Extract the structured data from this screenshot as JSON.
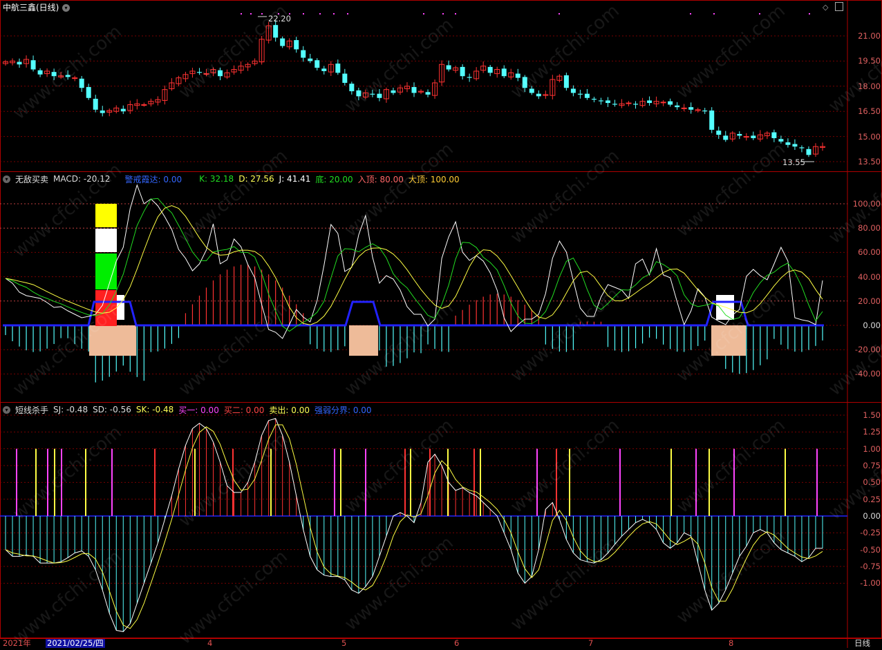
{
  "main": {
    "title": "中航三鑫(日线)",
    "high_label": "22.20",
    "low_label": "13.55",
    "axis": [
      "21.00",
      "19.50",
      "18.00",
      "16.50",
      "15.00",
      "13.50"
    ]
  },
  "ind1": {
    "name": "无敌买卖",
    "macd": "MACD: -20.12",
    "warn": "警戒霞达: 0.00",
    "k": "K: 32.18",
    "d": "D: 27.56",
    "j": "J: 41.41",
    "bottom": "底: 20.00",
    "entry": "入顶: 80.00",
    "top": "大顶: 100.00",
    "axis": [
      "100.00",
      "80.00",
      "60.00",
      "40.00",
      "20.00",
      "0.00",
      "-20.00",
      "-40.00"
    ]
  },
  "ind2": {
    "name": "短线杀手",
    "sj": "SJ: -0.48",
    "sd": "SD: -0.56",
    "sk": "SK: -0.48",
    "buy1": "买一: 0.00",
    "buy2": "买二: 0.00",
    "sell": "卖出: 0.00",
    "divide": "强弱分界: 0.00",
    "axis": [
      "1.50",
      "1.25",
      "1.00",
      "0.75",
      "0.50",
      "0.25",
      "0.00",
      "-0.25",
      "-0.50",
      "-0.75",
      "-1.00"
    ]
  },
  "timebar": {
    "year": "2021年",
    "cursor": "2021/02/25/四",
    "months": [
      "4",
      "5",
      "6",
      "7",
      "8"
    ],
    "period": "日线"
  },
  "watermark": "www.cfchi.com",
  "colors": {
    "up": "#ff3232",
    "down": "#54ffff",
    "kline": "#ffffff",
    "dline": "#22dd22",
    "jline": "#ffff44",
    "blue": "#2222ff"
  },
  "chart_data": {
    "type": "candlestick",
    "closes": [
      19.45,
      19.5,
      19.3,
      19.6,
      19.0,
      18.7,
      18.9,
      18.6,
      18.62,
      18.55,
      18.5,
      17.9,
      17.3,
      16.6,
      16.4,
      16.55,
      16.7,
      16.5,
      16.9,
      16.95,
      16.9,
      17.1,
      17.2,
      17.8,
      18.2,
      18.5,
      18.7,
      18.9,
      18.8,
      18.75,
      19.0,
      18.6,
      18.8,
      19.0,
      19.2,
      19.3,
      19.5,
      20.8,
      21.6,
      20.9,
      20.4,
      20.7,
      20.2,
      19.7,
      19.5,
      19.1,
      18.9,
      19.3,
      18.8,
      18.2,
      17.7,
      17.4,
      17.6,
      17.5,
      17.3,
      17.8,
      17.6,
      17.9,
      18.0,
      17.6,
      17.7,
      17.5,
      18.2,
      19.3,
      19.0,
      19.1,
      18.6,
      18.5,
      18.9,
      19.2,
      18.8,
      19.0,
      18.6,
      18.8,
      18.5,
      17.9,
      17.6,
      17.4,
      17.5,
      18.4,
      18.6,
      17.9,
      17.6,
      17.5,
      17.3,
      17.2,
      17.1,
      17.0,
      16.9,
      16.95,
      17.0,
      16.9,
      17.1,
      17.0,
      17.1,
      17.05,
      16.9,
      16.75,
      16.7,
      16.6,
      16.6,
      16.5,
      15.4,
      15.1,
      14.8,
      15.2,
      15.05,
      15.0,
      14.9,
      15.1,
      15.2,
      14.9,
      14.7,
      14.5,
      14.4,
      14.3,
      13.9,
      14.4,
      14.4
    ],
    "axis_range": [
      13.5,
      22.5
    ],
    "series_j_range": [
      -5,
      115
    ]
  }
}
